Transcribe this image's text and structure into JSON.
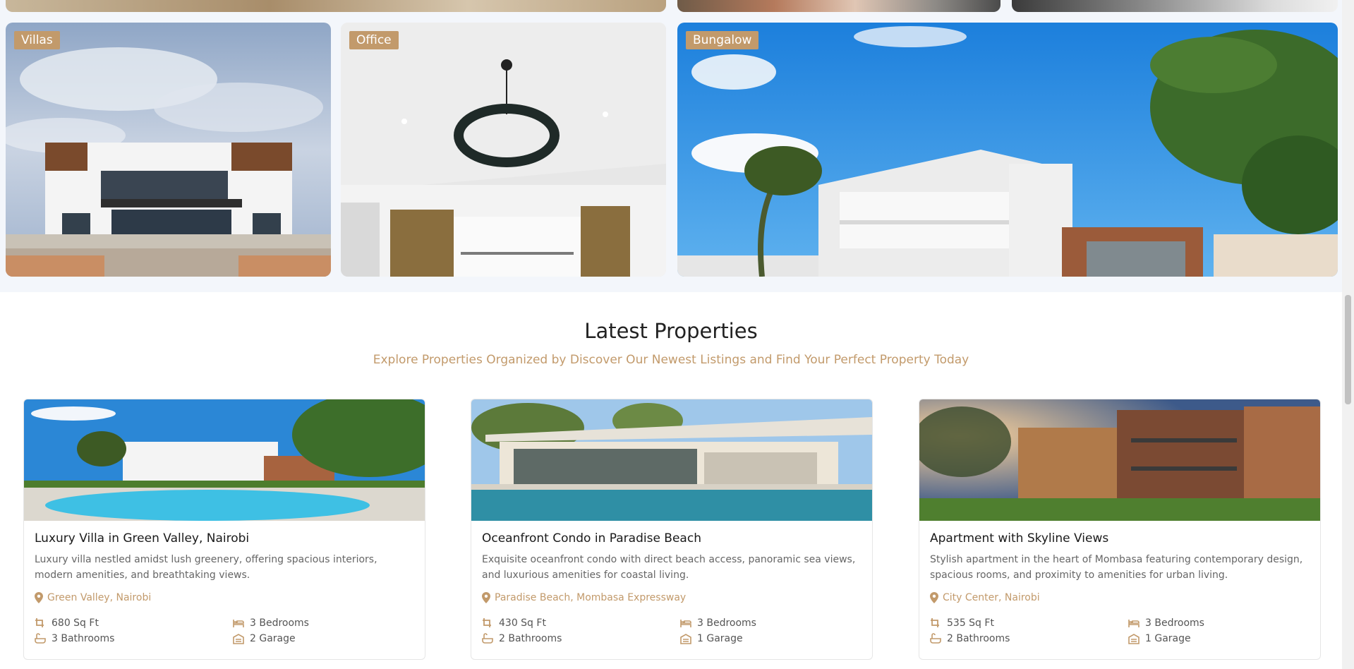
{
  "categories": [
    {
      "label": "Villas"
    },
    {
      "label": "Office"
    },
    {
      "label": "Bungalow"
    }
  ],
  "latest": {
    "title": "Latest Properties",
    "subtitle": "Explore Properties Organized by Discover Our Newest Listings and Find Your Perfect Property Today"
  },
  "properties": [
    {
      "title": "Luxury Villa in Green Valley, Nairobi",
      "description": "Luxury villa nestled amidst lush greenery, offering spacious interiors, modern amenities, and breathtaking views.",
      "location": "Green Valley, Nairobi",
      "area": "680 Sq Ft",
      "bedrooms": "3 Bedrooms",
      "bathrooms": "3 Bathrooms",
      "garage": "2 Garage"
    },
    {
      "title": "Oceanfront Condo in Paradise Beach",
      "description": "Exquisite oceanfront condo with direct beach access, panoramic sea views, and luxurious amenities for coastal living.",
      "location": "Paradise Beach, Mombasa Expressway",
      "area": "430 Sq Ft",
      "bedrooms": "3 Bedrooms",
      "bathrooms": "2 Bathrooms",
      "garage": "1 Garage"
    },
    {
      "title": "Apartment with Skyline Views",
      "description": "Stylish apartment in the heart of Mombasa featuring contemporary design, spacious rooms, and proximity to amenities for urban living.",
      "location": "City Center, Nairobi",
      "area": "535 Sq Ft",
      "bedrooms": "3 Bedrooms",
      "bathrooms": "2 Bathrooms",
      "garage": "1 Garage"
    }
  ],
  "colors": {
    "accent": "#c29a6b",
    "section_bg": "#f3f6fb"
  },
  "icons": [
    "map-pin-icon",
    "area-icon",
    "bed-icon",
    "bath-icon",
    "garage-icon"
  ]
}
